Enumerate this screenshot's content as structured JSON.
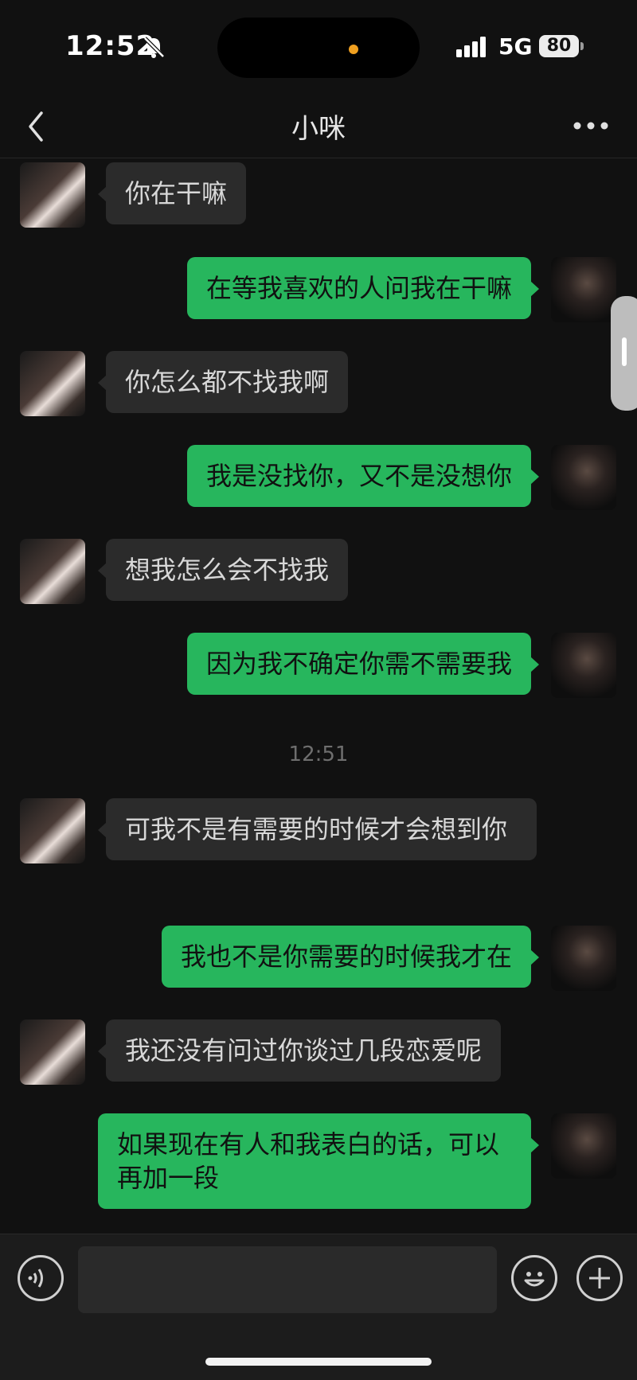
{
  "status_bar": {
    "time": "12:52",
    "network": "5G",
    "battery": "80"
  },
  "header": {
    "title": "小咪"
  },
  "messages": [
    {
      "side": "in",
      "text": "你在干嘛"
    },
    {
      "side": "out",
      "text": "在等我喜欢的人问我在干嘛"
    },
    {
      "side": "in",
      "text": "你怎么都不找我啊"
    },
    {
      "side": "out",
      "text": "我是没找你，又不是没想你"
    },
    {
      "side": "in",
      "text": "想我怎么会不找我"
    },
    {
      "side": "out",
      "text": "因为我不确定你需不需要我"
    },
    {
      "side": "in",
      "text": "可我不是有需要的时候才会想到你"
    },
    {
      "side": "out",
      "text": "我也不是你需要的时候我才在"
    },
    {
      "side": "in",
      "text": "我还没有问过你谈过几段恋爱呢"
    },
    {
      "side": "out",
      "text": "如果现在有人和我表白的话，可以再加一段"
    }
  ],
  "timestamp": "12:51",
  "input": {
    "placeholder": ""
  },
  "colors": {
    "outgoing_bubble": "#27b65d",
    "incoming_bubble": "#2b2b2b",
    "background": "#111111"
  }
}
